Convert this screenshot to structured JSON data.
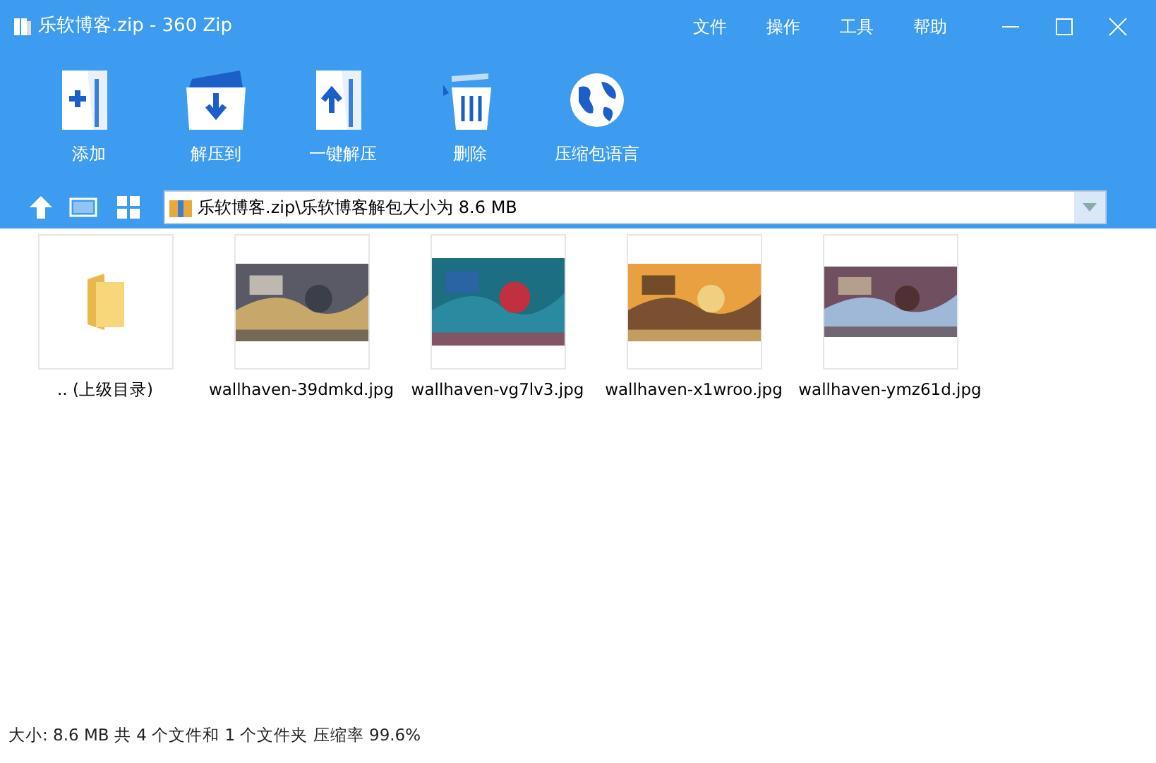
{
  "window": {
    "title": "乐软博客.zip - 360 Zip"
  },
  "menu": [
    "文件",
    "操作",
    "工具",
    "帮助"
  ],
  "toolbar": [
    {
      "kind": "add",
      "label": "添加"
    },
    {
      "kind": "extract-to",
      "label": "解压到"
    },
    {
      "kind": "extract",
      "label": "一键解压"
    },
    {
      "kind": "delete",
      "label": "删除"
    },
    {
      "kind": "language",
      "label": "压缩包语言"
    }
  ],
  "path": {
    "value": "乐软博客.zip\\乐软博客解包大小为 8.6 MB"
  },
  "files": [
    {
      "kind": "folder",
      "name": ".. (上级目录)"
    },
    {
      "kind": "picture",
      "name": "wallhaven-39dmkd.jpg"
    },
    {
      "kind": "picture",
      "name": "wallhaven-vg7lv3.jpg"
    },
    {
      "kind": "picture",
      "name": "wallhaven-x1wroo.jpg"
    },
    {
      "kind": "picture",
      "name": "wallhaven-ymz61d.jpg"
    }
  ],
  "status_bar": "大小: 8.6 MB 共 4 个文件和 1 个文件夹 压缩率 99.6%"
}
